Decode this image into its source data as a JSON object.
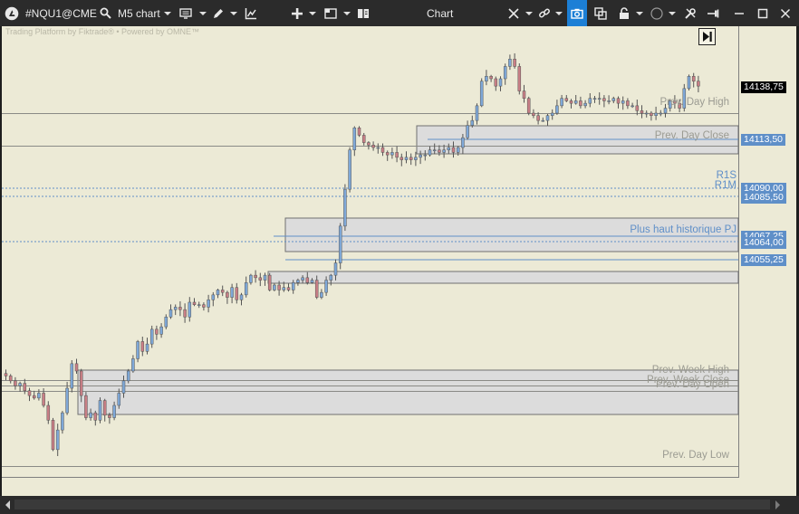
{
  "toolbar": {
    "symbol": "#NQU1@CME",
    "chart_type_label": "M5 chart",
    "window_title": "Chart"
  },
  "watermark": "Trading Platform by Fiktrade®  • Powered by OMNE™",
  "price_axis": {
    "last_price": "14138,75",
    "prev_day_close": "14113,50",
    "r1s": "14090,00",
    "r1m": "14085,50",
    "plus_haut_a": "14067,25",
    "plus_haut_b": "14064,00",
    "level_c": "14055,25"
  },
  "levels": {
    "prev_day_high": "Prev. Day High",
    "prev_day_close": "Prev. Day Close",
    "r1s": "R1S",
    "r1m": "R1M",
    "plus_haut": "Plus haut historique PJ",
    "prev_week_high": "Prev. Week High",
    "prev_week_close": "Prev. Week Close",
    "prev_day_open": "Prev. Day Open",
    "prev_day_low": "Prev. Day Low"
  },
  "chart_data": {
    "type": "candlestick",
    "symbol": "#NQU1@CME",
    "timeframe": "M5",
    "closes": [
      14020,
      14018,
      14016,
      14017,
      14014,
      14012,
      14011,
      14013,
      14008,
      14002,
      13990,
      13998,
      14005,
      14015,
      14025,
      14022,
      14012,
      14003,
      14005,
      14002,
      14010,
      14004,
      14003,
      14008,
      14013,
      14018,
      14022,
      14027,
      14034,
      14030,
      14033,
      14039,
      14037,
      14040,
      14044,
      14047,
      14048,
      14047,
      14044,
      14050,
      14049,
      14049,
      14048,
      14051,
      14053,
      14055,
      14054,
      14052,
      14056,
      14051,
      14053,
      14058,
      14061,
      14060,
      14059,
      14061,
      14055,
      14057,
      14055,
      14056,
      14055,
      14058,
      14059,
      14060,
      14058,
      14059,
      14052,
      14054,
      14059,
      14061,
      14066,
      14081,
      14096,
      14112,
      14121,
      14118,
      14115,
      14114,
      14113,
      14113,
      14111,
      14110,
      14111,
      14109,
      14108,
      14109,
      14108,
      14109,
      14110,
      14110,
      14112,
      14112,
      14111,
      14112,
      14113,
      14111,
      14113,
      14117,
      14122,
      14124,
      14130,
      14140,
      14142,
      14141,
      14138,
      14141,
      14146,
      14149,
      14146,
      14136,
      14133,
      14127,
      14126,
      14124,
      14124,
      14126,
      14127,
      14130,
      14133,
      14132,
      14131,
      14132,
      14130,
      14131,
      14133,
      14133,
      14133,
      14132,
      14132,
      14133,
      14131,
      14132,
      14130,
      14130,
      14128,
      14127,
      14127,
      14126,
      14127,
      14127,
      14129,
      14132,
      14131,
      14129,
      14137,
      14142,
      14140,
      14138
    ],
    "ylim": [
      13980,
      14155
    ]
  }
}
